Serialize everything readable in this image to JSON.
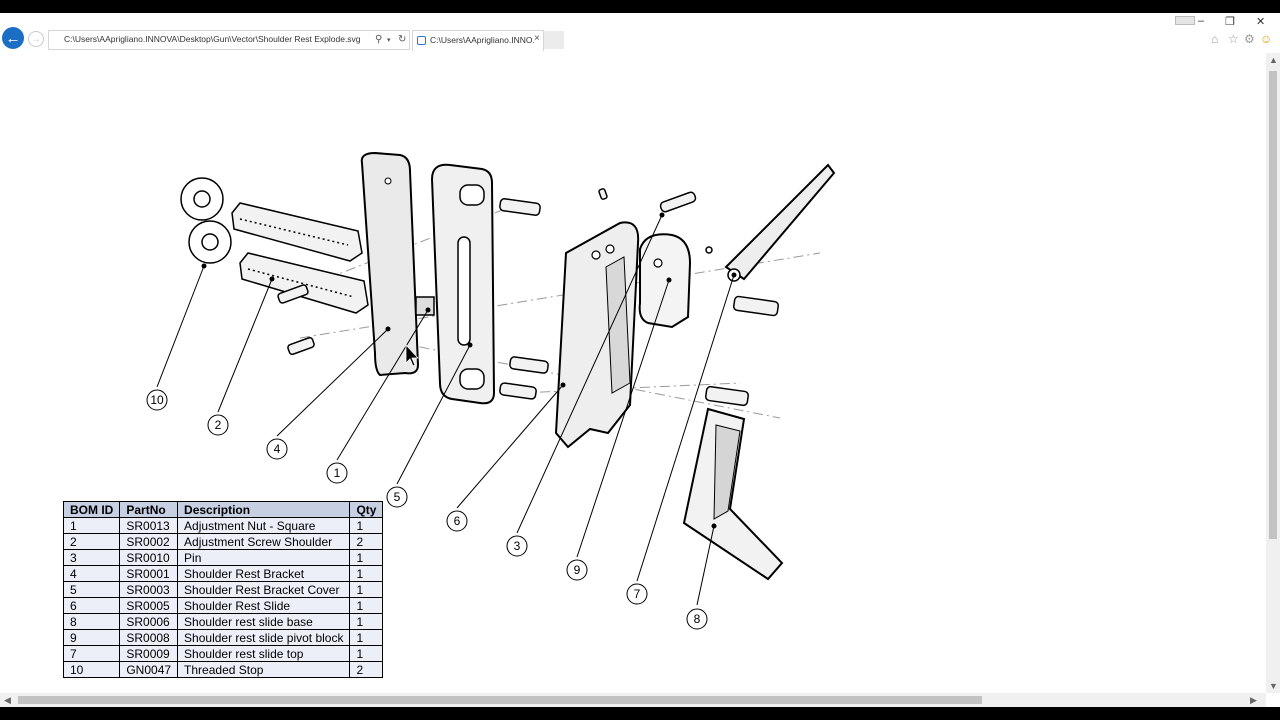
{
  "browser": {
    "address": "C:\\Users\\AAprigliano.INNOVA\\Desktop\\Gun\\Vector\\Shoulder Rest Explode.svg",
    "tab_title": "C:\\Users\\AAprigliano.INNO...",
    "tab_close": "×",
    "back_icon": "back-arrow-icon",
    "forward_icon": "forward-arrow-icon"
  },
  "window_controls": {
    "minimize": "–",
    "restore": "❐",
    "close": "✕"
  },
  "toolbar": {
    "home": "⌂",
    "favorites": "☆",
    "settings": "⚙",
    "feedback": "☺"
  },
  "callouts": [
    "10",
    "2",
    "4",
    "1",
    "5",
    "6",
    "3",
    "9",
    "7",
    "8"
  ],
  "bom": {
    "headers": [
      "BOM ID",
      "PartNo",
      "Description",
      "Qty"
    ],
    "rows": [
      [
        "1",
        "SR0013",
        "Adjustment Nut - Square",
        "1"
      ],
      [
        "2",
        "SR0002",
        "Adjustment Screw Shoulder",
        "2"
      ],
      [
        "3",
        "SR0010",
        "Pin",
        "1"
      ],
      [
        "4",
        "SR0001",
        "Shoulder Rest Bracket",
        "1"
      ],
      [
        "5",
        "SR0003",
        "Shoulder Rest Bracket Cover",
        "1"
      ],
      [
        "6",
        "SR0005",
        "Shoulder Rest Slide",
        "1"
      ],
      [
        "8",
        "SR0006",
        "Shoulder rest slide base",
        "1"
      ],
      [
        "9",
        "SR0008",
        "Shoulder rest slide pivot block",
        "1"
      ],
      [
        "7",
        "SR0009",
        "Shoulder rest slide top",
        "1"
      ],
      [
        "10",
        "GN0047",
        "Threaded Stop",
        "2"
      ]
    ]
  }
}
